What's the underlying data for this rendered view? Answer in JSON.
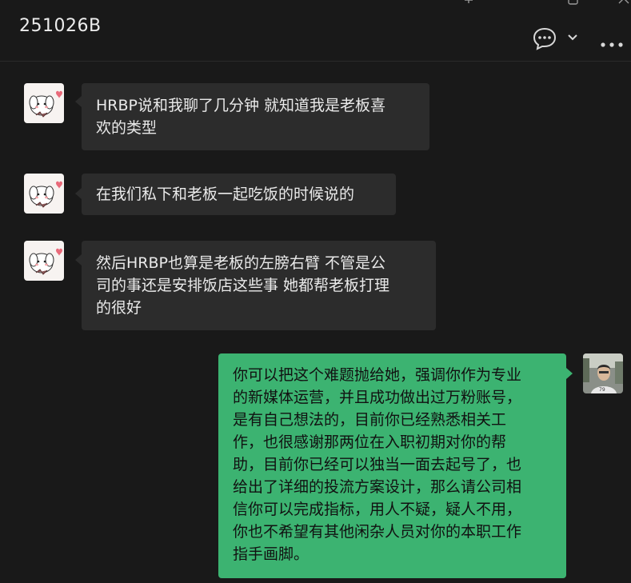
{
  "header": {
    "title": "251026B",
    "icons": [
      "chat-bubble-icon",
      "chevron-down-icon",
      "more-options-icon"
    ],
    "window_controls": [
      "pin-icon",
      "maximize-icon",
      "close-icon"
    ]
  },
  "messages": [
    {
      "side": "left",
      "text": "HRBP说和我聊了几分钟 就知道我是老板喜欢的类型",
      "lines": [
        "HRBP说和我聊了几分钟 就知道我是老板喜",
        "欢的类型"
      ]
    },
    {
      "side": "left",
      "text": "在我们私下和老板一起吃饭的时候说的",
      "lines": [
        "在我们私下和老板一起吃饭的时候说的"
      ]
    },
    {
      "side": "left",
      "text": "然后HRBP也算是老板的左膀右臂 不管是公司的事还是安排饭店这些事 她都帮老板打理的很好",
      "lines": [
        "然后HRBP也算是老板的左膀右臂 不管是公",
        "司的事还是安排饭店这些事 她都帮老板打理",
        "的很好"
      ]
    },
    {
      "side": "right",
      "text": "你可以把这个难题抛给她，强调你作为专业的新媒体运营，并且成功做出过万粉账号，是有自己想法的，目前你已经熟悉相关工作，也很感谢那两位在入职初期对你的帮助，目前你已经可以独当一面去起号了，也给出了详细的投流方案设计，那么请公司相信你可以完成指标，用人不疑，疑人不用，你也不希望有其他闲杂人员对你的本职工作指手画脚。",
      "lines": [
        "你可以把这个难题抛给她，强调你作为专业",
        "的新媒体运营，并且成功做出过万粉账号，",
        "是有自己想法的，目前你已经熟悉相关工",
        "作，也很感谢那两位在入职初期对你的帮",
        "助，目前你已经可以独当一面去起号了，也",
        "给出了详细的投流方案设计，那么请公司相",
        "信你可以完成指标，用人不疑，疑人不用，",
        "你也不希望有其他闲杂人员对你的本职工作",
        "指手画脚。"
      ]
    }
  ],
  "colors": {
    "background": "#191919",
    "left_bubble": "#2c2c2c",
    "right_bubble": "#3cb371",
    "left_text": "#eaeaea",
    "right_text": "#111111"
  }
}
